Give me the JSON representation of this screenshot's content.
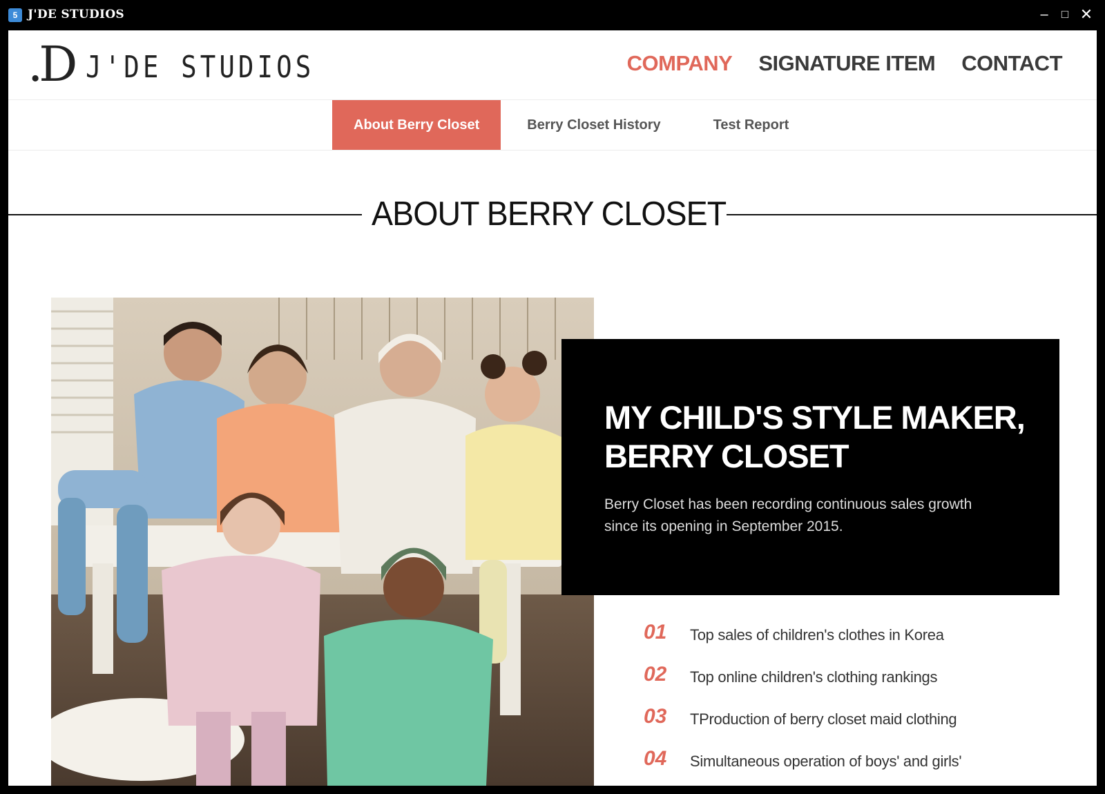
{
  "window": {
    "title": "J'DE STUDIOS",
    "controls": {
      "minimize": "–",
      "maximize": "□",
      "close": "✕"
    }
  },
  "brand": {
    "mark": ".D",
    "name": "J'DE STUDIOS"
  },
  "nav": {
    "items": [
      "COMPANY",
      "SIGNATURE ITEM",
      "CONTACT"
    ],
    "active": "COMPANY",
    "accent_color": "#e0685a"
  },
  "subnav": {
    "items": [
      "About Berry Closet",
      "Berry Closet History",
      "Test Report"
    ],
    "active": "About Berry Closet"
  },
  "section": {
    "title": "ABOUT BERRY CLOSET"
  },
  "hero": {
    "headline_line1": "MY CHILD'S STYLE MAKER,",
    "headline_line2": "BERRY CLOSET",
    "body_line1": "Berry Closet has been recording continuous sales growth",
    "body_line2": "since its opening in September 2015."
  },
  "features": [
    {
      "num": "01",
      "text": "Top sales of children's clothes in Korea"
    },
    {
      "num": "02",
      "text": "Top online children's clothing rankings"
    },
    {
      "num": "03",
      "text": "TProduction of berry closet maid clothing"
    },
    {
      "num": "04",
      "text": "Simultaneous operation of boys' and girls'"
    }
  ]
}
